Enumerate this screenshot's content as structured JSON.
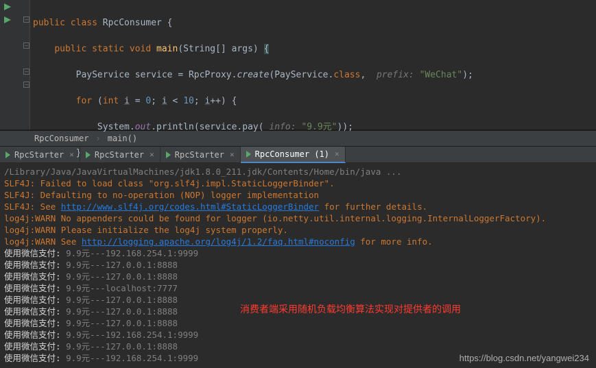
{
  "code": {
    "class_kw": "public class",
    "class_name": "RpcConsumer",
    "brace_open": "{",
    "main_sig1": "public static void",
    "main_name": "main",
    "main_sig2": "(String[] args)",
    "main_brace": "{",
    "line3_a": "PayService service = RpcProxy.",
    "line3_create": "create",
    "line3_b": "(PayService.",
    "line3_class": "class",
    "line3_comma": ", ",
    "hint_prefix": " prefix: ",
    "str_wechat": "\"WeChat\"",
    "line3_end": ");",
    "for_kw": "for",
    "for_open": " (",
    "int_kw": "int",
    "var_i": "i",
    "eq": " = ",
    "zero": "0",
    "semi": "; ",
    "lt": " < ",
    "ten": "10",
    "inc": "++) {",
    "sys": "System.",
    "out": "out",
    "println": ".println(service.pay(",
    "hint_info": " info: ",
    "str_99": "\"9.9元\"",
    "println_end": "));",
    "close1": "}",
    "close2": "}",
    "close3": "}"
  },
  "breadcrumb": {
    "item1": "RpcConsumer",
    "item2": "main()"
  },
  "tabs": [
    {
      "label": "RpcStarter"
    },
    {
      "label": "RpcStarter"
    },
    {
      "label": "RpcStarter"
    },
    {
      "label": "RpcConsumer (1)"
    }
  ],
  "console": {
    "line1": "/Library/Java/JavaVirtualMachines/jdk1.8.0_211.jdk/Contents/Home/bin/java ...",
    "slf_a": "SLF4J: Failed to load class \"org.slf4j.impl.StaticLoggerBinder\".",
    "slf_b": "SLF4J: Defaulting to no-operation (NOP) logger implementation",
    "slf_c_pre": "SLF4J: See ",
    "slf_c_link": "http://www.slf4j.org/codes.html#StaticLoggerBinder",
    "slf_c_post": " for further details.",
    "log_a": "log4j:WARN No appenders could be found for logger (io.netty.util.internal.logging.InternalLoggerFactory).",
    "log_b": "log4j:WARN Please initialize the log4j system properly.",
    "log_c_pre": "log4j:WARN See ",
    "log_c_link": "http://logging.apache.org/log4j/1.2/faq.html#noconfig",
    "log_c_post": " for more info.",
    "out_label": "使用微信支付:",
    "rows": [
      "9.9元---192.168.254.1:9999",
      "9.9元---127.0.0.1:8888",
      "9.9元---127.0.0.1:8888",
      "9.9元---localhost:7777",
      "9.9元---127.0.0.1:8888",
      "9.9元---127.0.0.1:8888",
      "9.9元---127.0.0.1:8888",
      "9.9元---192.168.254.1:9999",
      "9.9元---127.0.0.1:8888",
      "9.9元---192.168.254.1:9999"
    ]
  },
  "annotation": "消费者端采用随机负载均衡算法实现对提供者的调用",
  "watermark": "https://blog.csdn.net/yangwei234"
}
